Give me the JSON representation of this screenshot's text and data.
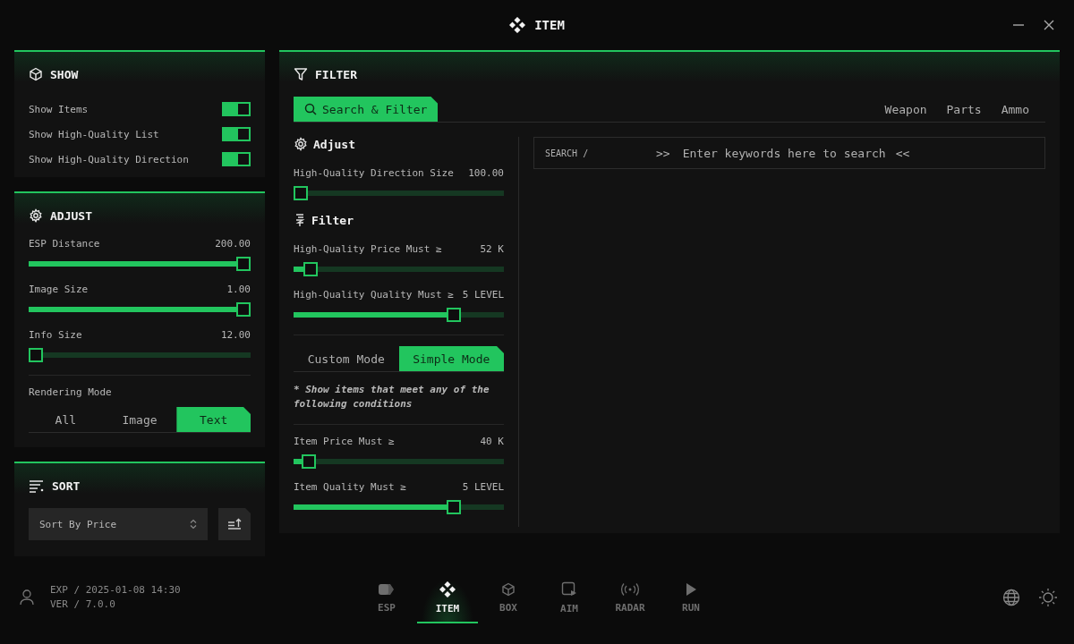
{
  "window": {
    "title": "ITEM"
  },
  "show": {
    "title": "SHOW",
    "toggles": [
      {
        "label": "Show Items",
        "on": true
      },
      {
        "label": "Show High-Quality List",
        "on": true
      },
      {
        "label": "Show High-Quality Direction",
        "on": true
      }
    ]
  },
  "adjust": {
    "title": "ADJUST",
    "sliders": [
      {
        "label": "ESP Distance",
        "reading": "200.00",
        "level": 1
      },
      {
        "label": "Image Size",
        "reading": "1.00",
        "level": 1
      },
      {
        "label": "Info Size",
        "reading": "12.00",
        "level": 0
      }
    ],
    "rendering_mode": {
      "label": "Rendering Mode",
      "options": [
        {
          "label": "All",
          "selected": false
        },
        {
          "label": "Image",
          "selected": false
        },
        {
          "label": "Text",
          "selected": true
        }
      ]
    }
  },
  "sort": {
    "title": "SORT",
    "select": {
      "value": "Sort By Price"
    }
  },
  "filter": {
    "title": "FILTER",
    "tabs": [
      {
        "label": "Search & Filter",
        "selected": true
      }
    ],
    "categories": [
      {
        "label": "Weapon",
        "selected": false
      },
      {
        "label": "Parts",
        "selected": false
      },
      {
        "label": "Ammo",
        "selected": false
      }
    ],
    "adjust_section": {
      "title": "Adjust",
      "sliders": [
        {
          "label": "High-Quality Direction Size",
          "reading": "100.00",
          "level": 0
        }
      ]
    },
    "filter_section": {
      "title": "Filter",
      "sliders": [
        {
          "label": "High-Quality Price Must ≥",
          "reading": "52 K",
          "level": 0.05
        },
        {
          "label": "High-Quality Quality Must ≥",
          "reading": "5 LEVEL",
          "level": 0.78
        }
      ],
      "modes": [
        {
          "label": "Custom Mode",
          "selected": false
        },
        {
          "label": "Simple Mode",
          "selected": true
        }
      ],
      "note": "* Show items that meet any of the following conditions",
      "item_sliders": [
        {
          "label": "Item Price Must ≥",
          "reading": "40 K",
          "level": 0.04
        },
        {
          "label": "Item Quality Must ≥",
          "reading": "5 LEVEL",
          "level": 0.78
        }
      ]
    },
    "search": {
      "label": "SEARCH /",
      "prefix": ">>",
      "placeholder": "Enter keywords here to search",
      "suffix": "<<"
    }
  },
  "footer": {
    "exp": "EXP / 2025-01-08 14:30",
    "ver": "VER / 7.0.0"
  },
  "nav": [
    {
      "label": "ESP",
      "selected": false
    },
    {
      "label": "ITEM",
      "selected": true
    },
    {
      "label": "BOX",
      "selected": false
    },
    {
      "label": "AIM",
      "selected": false
    },
    {
      "label": "RADAR",
      "selected": false
    },
    {
      "label": "RUN",
      "selected": false
    }
  ]
}
